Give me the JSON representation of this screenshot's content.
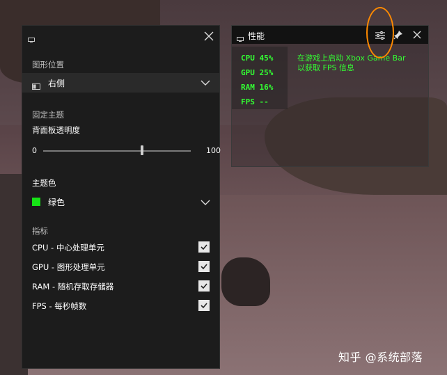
{
  "settings_panel": {
    "section_position": "图形位置",
    "position_value": "右侧",
    "section_theme": "固定主题",
    "opacity_label": "背面板透明度",
    "opacity_min": "0",
    "opacity_max": "100",
    "opacity_level": 0.67,
    "accent_label": "主题色",
    "accent_value": "绿色",
    "accent_color": "#16e316",
    "metrics_label": "指标",
    "metrics": [
      {
        "label": "CPU - 中心处理单元",
        "checked": true
      },
      {
        "label": "GPU - 图形处理单元",
        "checked": true
      },
      {
        "label": "RAM - 随机存取存储器",
        "checked": true
      },
      {
        "label": "FPS - 每秒帧数",
        "checked": true
      }
    ]
  },
  "perf_overlay": {
    "title": "性能",
    "stats": [
      {
        "label": "CPU  45%"
      },
      {
        "label": "GPU  25%"
      },
      {
        "label": "RAM  16%"
      },
      {
        "label": "FPS --"
      }
    ],
    "info_line1": "在游戏上启动 Xbox Game Bar",
    "info_line2": "以获取 FPS 信息",
    "text_color": "#33ff33"
  },
  "watermark": "知乎 @系统部落",
  "icons": [
    "monitor-icon",
    "close-icon",
    "chevron-down-icon",
    "tune-icon",
    "pin-icon",
    "checkmark-icon"
  ]
}
